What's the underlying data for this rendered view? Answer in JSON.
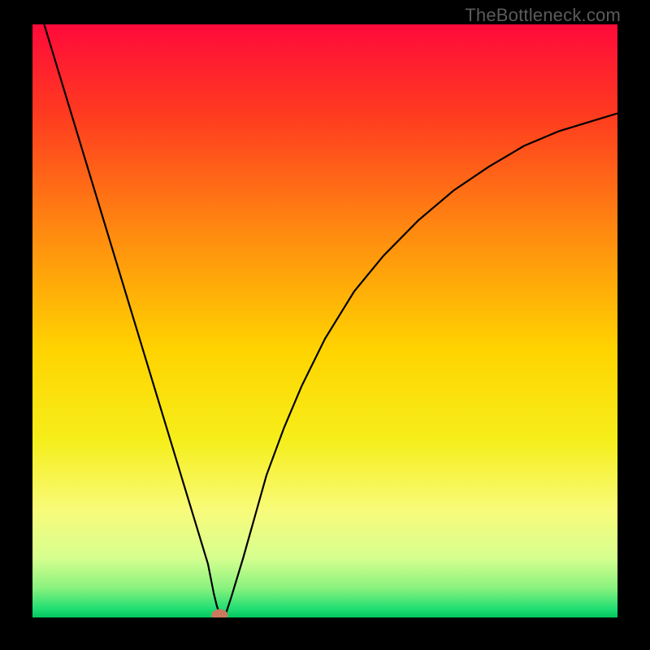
{
  "watermark": "TheBottleneck.com",
  "chart_data": {
    "type": "line",
    "title": "",
    "xlabel": "",
    "ylabel": "",
    "xlim": [
      0,
      100
    ],
    "ylim": [
      0,
      100
    ],
    "background": {
      "type": "vertical-gradient",
      "stops": [
        {
          "offset": 0.0,
          "color": "#ff0a3a"
        },
        {
          "offset": 0.15,
          "color": "#ff3a20"
        },
        {
          "offset": 0.35,
          "color": "#ff8a10"
        },
        {
          "offset": 0.55,
          "color": "#ffd400"
        },
        {
          "offset": 0.7,
          "color": "#f6ee1a"
        },
        {
          "offset": 0.82,
          "color": "#f8fb7a"
        },
        {
          "offset": 0.9,
          "color": "#d6ff8f"
        },
        {
          "offset": 0.95,
          "color": "#8af27e"
        },
        {
          "offset": 0.985,
          "color": "#21de73"
        },
        {
          "offset": 1.0,
          "color": "#00c75e"
        }
      ]
    },
    "series": [
      {
        "name": "curve",
        "color": "#000000",
        "width": 2.2,
        "x": [
          2,
          4,
          6,
          8,
          10,
          12,
          14,
          16,
          18,
          20,
          22,
          24,
          26,
          27,
          28,
          29,
          30,
          30.5,
          31,
          31.5,
          32,
          33,
          34,
          36,
          38,
          40,
          43,
          46,
          50,
          55,
          60,
          66,
          72,
          78,
          84,
          90,
          95,
          100
        ],
        "y": [
          100,
          93.5,
          87,
          80.5,
          74,
          67.5,
          61,
          54.5,
          48,
          41.5,
          35,
          28.5,
          22,
          18.75,
          15.5,
          12.25,
          9,
          6.5,
          4,
          2,
          0.5,
          0.5,
          3.5,
          10,
          17,
          24,
          32,
          39,
          47,
          55,
          61,
          67,
          72,
          76,
          79.5,
          82,
          83.5,
          85
        ]
      }
    ],
    "marker": {
      "x": 32,
      "y": 0.4,
      "rx": 1.4,
      "ry": 1.0,
      "color": "#c97a5e"
    }
  }
}
